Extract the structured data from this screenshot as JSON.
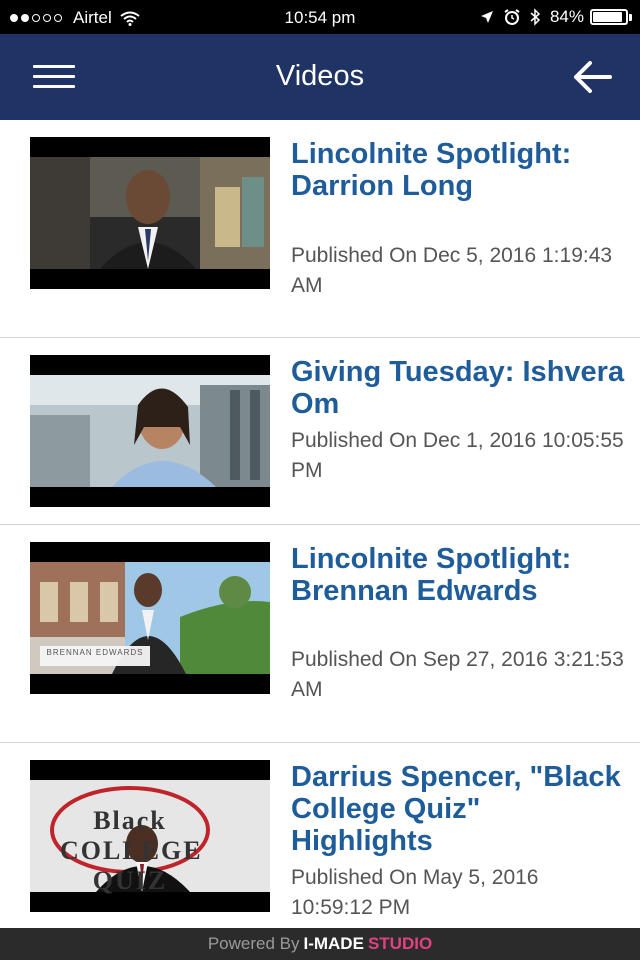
{
  "status_bar": {
    "carrier": "Airtel",
    "time": "10:54 pm",
    "battery_percent": "84%",
    "battery_level": 0.84,
    "signal_bars": 2,
    "signal_total": 5
  },
  "header": {
    "title": "Videos",
    "menu_icon": "hamburger-menu-icon",
    "back_icon": "arrow-left-icon",
    "background": "#1f3364"
  },
  "videos": [
    {
      "title": "Lincolnite Spotlight: Darrion Long",
      "published": "Published On Dec 5, 2016 1:19:43 AM"
    },
    {
      "title": "Giving Tuesday: Ishvera Om",
      "published": "Published On Dec 1, 2016 10:05:55 PM"
    },
    {
      "title": "Lincolnite Spotlight: Brennan Edwards",
      "published": "Published On Sep 27, 2016 3:21:53 AM",
      "thumb_caption": "BRENNAN EDWARDS"
    },
    {
      "title": "Darrius Spencer, \"Black College Quiz\" Highlights",
      "published": "Published On May 5, 2016 10:59:12 PM",
      "thumb_caption": "Black COLLEGE QUIZ"
    }
  ],
  "footer": {
    "powered_by": "Powered By",
    "brand_primary": "I-MADE",
    "brand_secondary": "STUDIO"
  },
  "colors": {
    "title_text": "#1f5c9a",
    "accent_pink": "#e1417f"
  }
}
